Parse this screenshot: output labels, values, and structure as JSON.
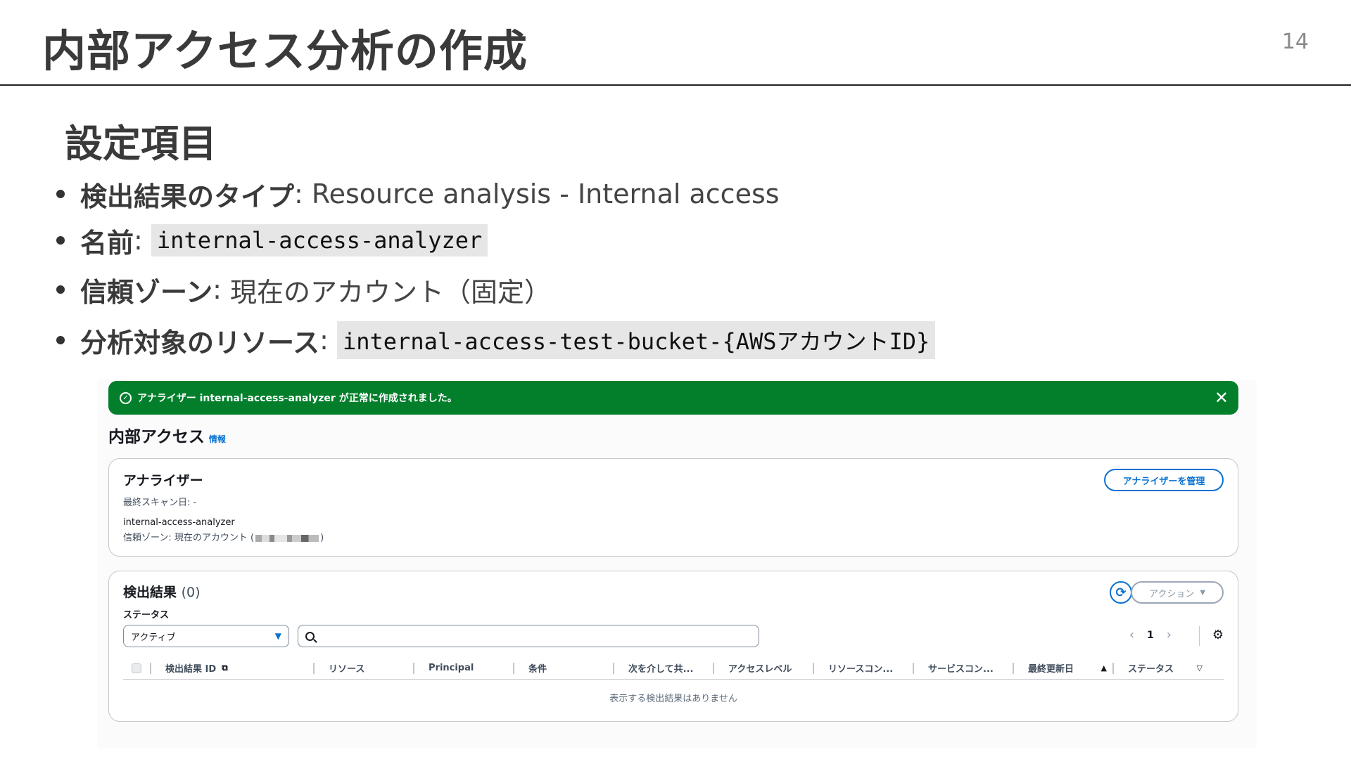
{
  "slide": {
    "title": "内部アクセス分析の作成",
    "page_number": "14",
    "section_heading": "設定項目",
    "bullets": [
      {
        "key": "検出結果のタイプ",
        "sep": ": ",
        "value": "Resource analysis - Internal access"
      },
      {
        "key": "名前",
        "sep": ": ",
        "code": "internal-access-analyzer"
      },
      {
        "key": "信頼ゾーン",
        "sep": ": ",
        "value": "現在のアカウント（固定）"
      },
      {
        "key": "分析対象のリソース",
        "sep": ": ",
        "code": "internal-access-test-bucket-{AWSアカウントID}"
      }
    ]
  },
  "console": {
    "flash": {
      "message": "アナライザー internal-access-analyzer が正常に作成されました。",
      "status_color": "#037f2c"
    },
    "heading": "内部アクセス",
    "info_link": "情報",
    "analyzer_card": {
      "title": "アナライザー",
      "last_scan": "最終スキャン日: -",
      "analyzer_name": "internal-access-analyzer",
      "trust_zone_prefix": "信頼ゾーン: 現在のアカウント (",
      "trust_zone_suffix": ")",
      "manage_button": "アナライザーを管理"
    },
    "findings_card": {
      "title": "検出結果",
      "count": "(0)",
      "actions_button": "アクション",
      "status_label": "ステータス",
      "status_value": "アクティブ",
      "search_value": "",
      "search_placeholder": "",
      "page_current": "1",
      "columns": [
        "検出結果 ID",
        "リソース",
        "Principal",
        "条件",
        "次を介して共...",
        "アクセスレベル",
        "リソースコン...",
        "サービスコン...",
        "最終更新日",
        "ステータス"
      ],
      "empty_message": "表示する検出結果はありません"
    },
    "accent_color": "#0972d3"
  }
}
